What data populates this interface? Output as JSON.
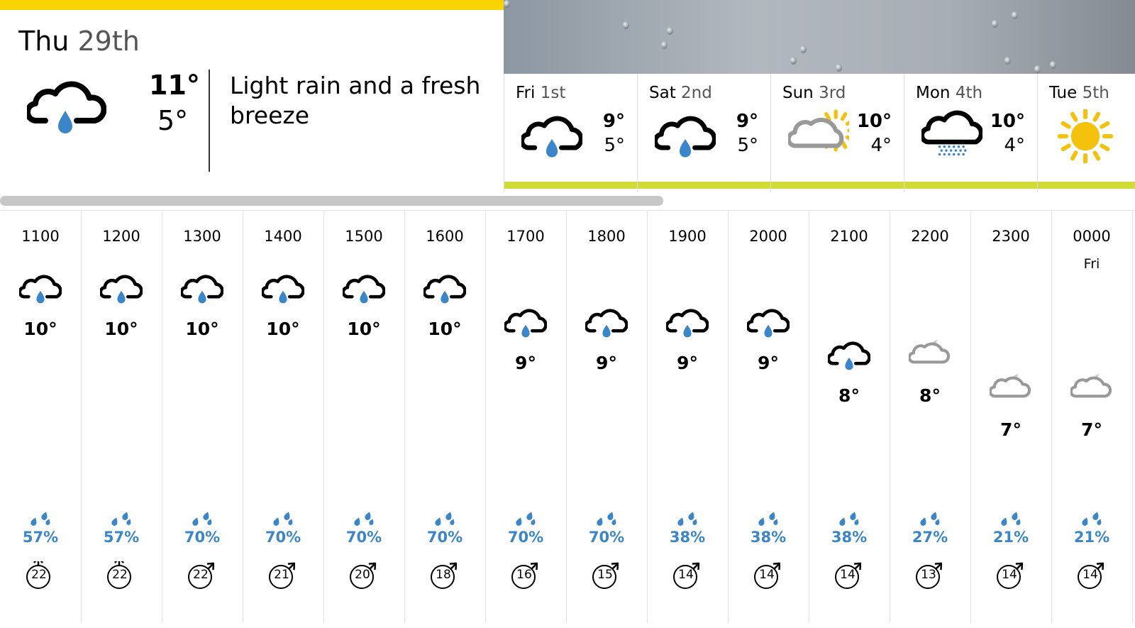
{
  "today": {
    "day": "Thu",
    "date": "29th",
    "max": "11°",
    "min": "5°",
    "description": "Light rain and a fresh breeze",
    "icon": "light-rain-icon",
    "bar_color": "#f8d400"
  },
  "days": [
    {
      "day": "Fri",
      "date": "1st",
      "max": "9°",
      "min": "5°",
      "icon": "light-rain-icon"
    },
    {
      "day": "Sat",
      "date": "2nd",
      "max": "9°",
      "min": "5°",
      "icon": "light-rain-icon"
    },
    {
      "day": "Sun",
      "date": "3rd",
      "max": "10°",
      "min": "4°",
      "icon": "sunny-intervals-icon"
    },
    {
      "day": "Mon",
      "date": "4th",
      "max": "10°",
      "min": "4°",
      "icon": "drizzle-icon"
    },
    {
      "day": "Tue",
      "date": "5th",
      "max": "",
      "min": "",
      "icon": "sunny-icon"
    }
  ],
  "hours": [
    {
      "time": "1100",
      "day": "",
      "temp": "10°",
      "icon": "light-rain-icon",
      "rain": "57%",
      "wind": "22",
      "wind_dir": "S"
    },
    {
      "time": "1200",
      "day": "",
      "temp": "10°",
      "icon": "light-rain-icon",
      "rain": "57%",
      "wind": "22",
      "wind_dir": "S"
    },
    {
      "time": "1300",
      "day": "",
      "temp": "10°",
      "icon": "light-rain-icon",
      "rain": "70%",
      "wind": "22",
      "wind_dir": "SW"
    },
    {
      "time": "1400",
      "day": "",
      "temp": "10°",
      "icon": "light-rain-icon",
      "rain": "70%",
      "wind": "21",
      "wind_dir": "SW"
    },
    {
      "time": "1500",
      "day": "",
      "temp": "10°",
      "icon": "light-rain-icon",
      "rain": "70%",
      "wind": "20",
      "wind_dir": "SW"
    },
    {
      "time": "1600",
      "day": "",
      "temp": "10°",
      "icon": "light-rain-icon",
      "rain": "70%",
      "wind": "18",
      "wind_dir": "SW"
    },
    {
      "time": "1700",
      "day": "",
      "temp": "9°",
      "icon": "light-rain-icon",
      "rain": "70%",
      "wind": "16",
      "wind_dir": "SW"
    },
    {
      "time": "1800",
      "day": "",
      "temp": "9°",
      "icon": "light-rain-icon",
      "rain": "70%",
      "wind": "15",
      "wind_dir": "SW"
    },
    {
      "time": "1900",
      "day": "",
      "temp": "9°",
      "icon": "light-rain-icon",
      "rain": "38%",
      "wind": "14",
      "wind_dir": "SW"
    },
    {
      "time": "2000",
      "day": "",
      "temp": "9°",
      "icon": "light-rain-icon",
      "rain": "38%",
      "wind": "14",
      "wind_dir": "SW"
    },
    {
      "time": "2100",
      "day": "",
      "temp": "8°",
      "icon": "light-rain-icon",
      "rain": "38%",
      "wind": "14",
      "wind_dir": "SW"
    },
    {
      "time": "2200",
      "day": "",
      "temp": "8°",
      "icon": "partly-cloudy-night-icon",
      "rain": "27%",
      "wind": "13",
      "wind_dir": "SW"
    },
    {
      "time": "2300",
      "day": "",
      "temp": "7°",
      "icon": "partly-cloudy-night-icon",
      "rain": "21%",
      "wind": "14",
      "wind_dir": "SW"
    },
    {
      "time": "0000",
      "day": "Fri",
      "temp": "7°",
      "icon": "partly-cloudy-night-icon",
      "rain": "21%",
      "wind": "14",
      "wind_dir": "SW"
    }
  ],
  "colors": {
    "today_bar": "#f8d400",
    "day_stripe": "#cfdc35",
    "rain_blue": "#3a86c8",
    "sun": "#f4c20d"
  }
}
